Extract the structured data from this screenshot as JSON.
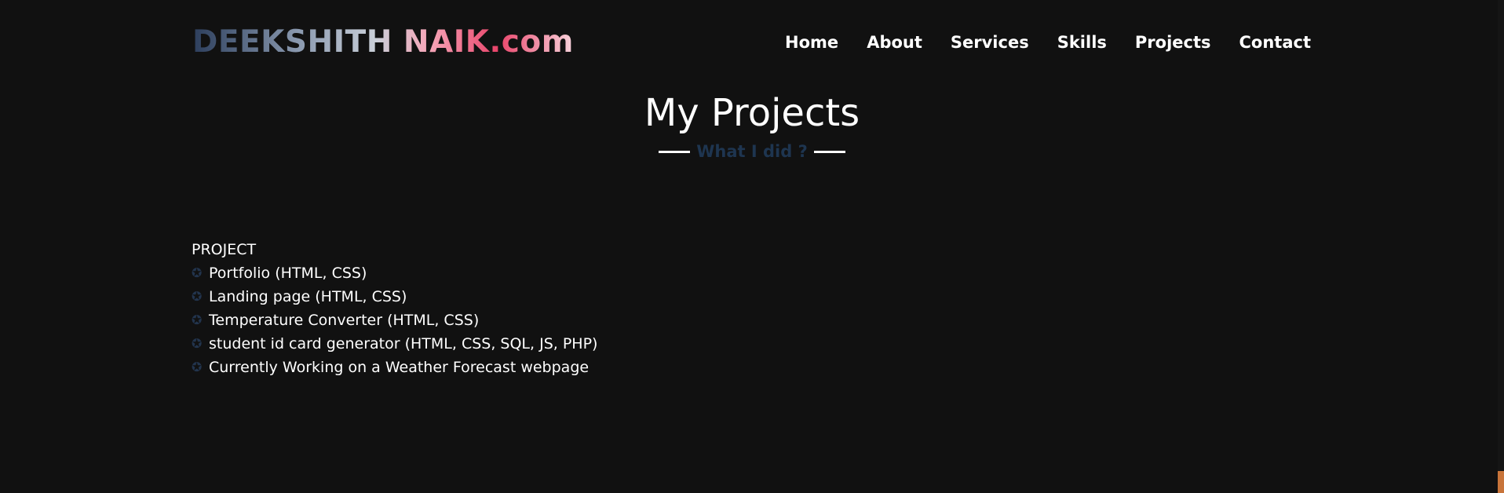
{
  "header": {
    "logo": "DEEKSHITH NAIK.com",
    "nav": [
      "Home",
      "About",
      "Services",
      "Skills",
      "Projects",
      "Contact"
    ]
  },
  "section": {
    "title": "My Projects",
    "subtitle": "What I did ?"
  },
  "projects": {
    "heading": "PROJECT",
    "bullet_icon": "star-outline-icon",
    "items": [
      "Portfolio (HTML, CSS)",
      "Landing page (HTML, CSS)",
      "Temperature Converter (HTML, CSS)",
      "student id card generator (HTML, CSS, SQL, JS, PHP)",
      "Currently Working on a Weather Forecast webpage"
    ]
  },
  "colors": {
    "background": "#111111",
    "subtitle": "#1e3550",
    "bullet": "#22344d"
  }
}
